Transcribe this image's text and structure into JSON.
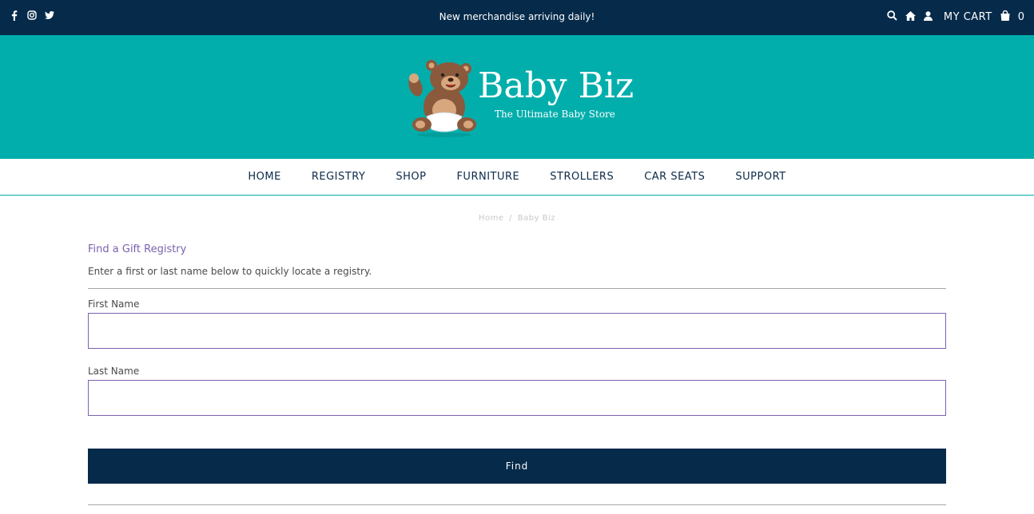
{
  "topbar": {
    "announcement": "New merchandise arriving daily!",
    "social": [
      "facebook-icon",
      "instagram-icon",
      "twitter-icon"
    ],
    "cart_label": "MY CART",
    "cart_count": "0"
  },
  "brand": {
    "name": "Baby Biz",
    "tagline": "The Ultimate Baby Store"
  },
  "nav": {
    "items": [
      "HOME",
      "REGISTRY",
      "SHOP",
      "FURNITURE",
      "STROLLERS",
      "CAR SEATS",
      "SUPPORT"
    ]
  },
  "breadcrumb": {
    "home": "Home",
    "separator": "/",
    "current": "Baby Biz"
  },
  "registry": {
    "title": "Find a Gift Registry",
    "intro": "Enter a first or last name below to quickly locate a registry.",
    "first_name_label": "First Name",
    "first_name_value": "",
    "last_name_label": "Last Name",
    "last_name_value": "",
    "find_label": "Find"
  },
  "colors": {
    "topbar": "#062a4a",
    "header": "#02aeac",
    "accent": "#7b62ad"
  }
}
